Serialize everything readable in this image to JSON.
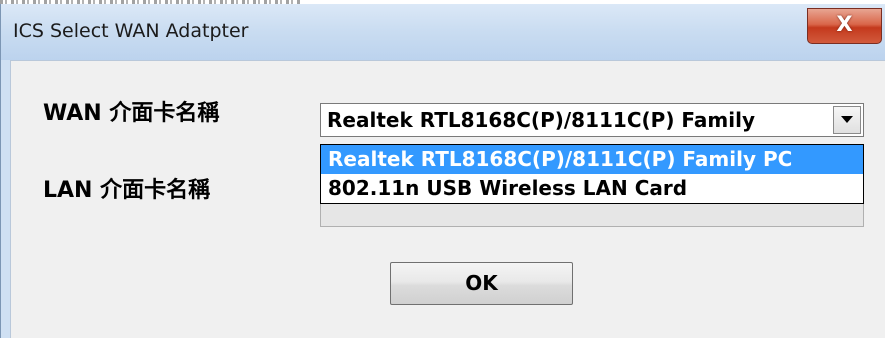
{
  "window": {
    "title": "ICS Select WAN Adatpter",
    "close_glyph": "X"
  },
  "form": {
    "wan_label": "WAN 介面卡名稱",
    "lan_label": "LAN 介面卡名稱",
    "wan_selected_value": "Realtek RTL8168C(P)/8111C(P) Family"
  },
  "dropdown": {
    "options": [
      "Realtek RTL8168C(P)/8111C(P) Family PC",
      "802.11n USB Wireless LAN Card"
    ],
    "highlighted_index": 0
  },
  "buttons": {
    "ok_label": "OK"
  },
  "colors": {
    "selection": "#3399ff",
    "title_bar": "#c9dcf1",
    "close_button": "#c4391d",
    "dialog_background": "#f0f0f0"
  },
  "icons": {
    "close": "close-icon",
    "dropdown": "chevron-down-icon"
  }
}
